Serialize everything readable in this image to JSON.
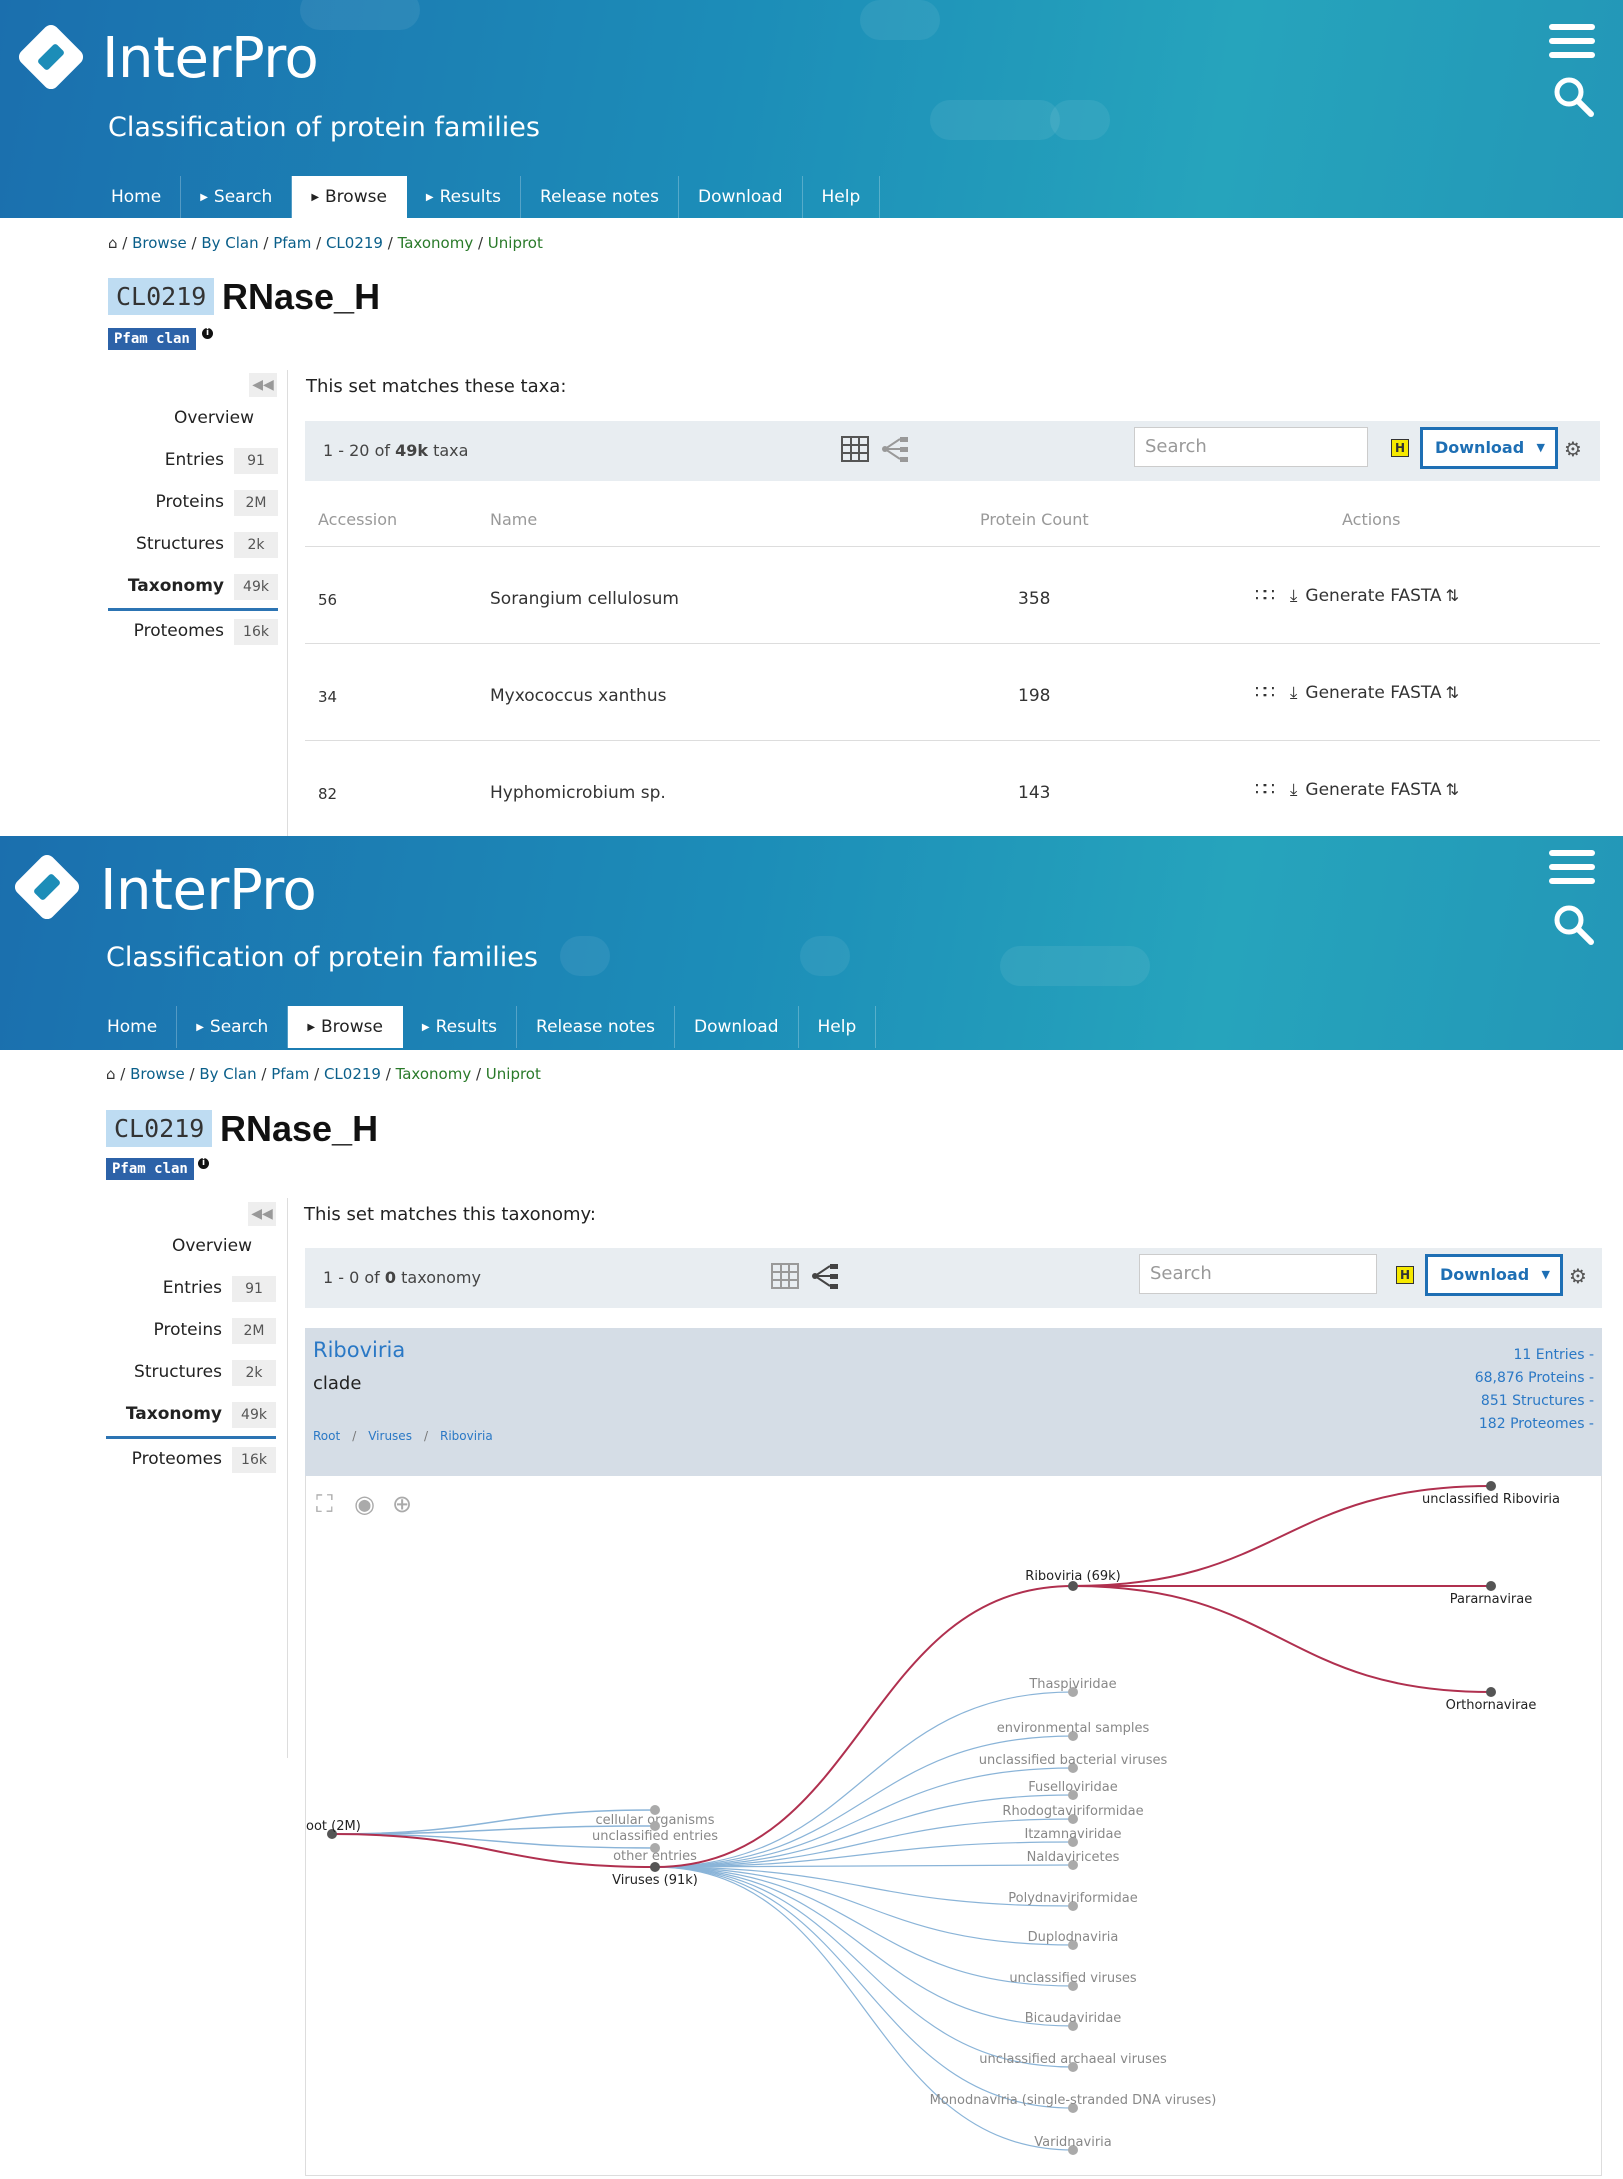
{
  "header": {
    "brand": "InterPro",
    "tagline": "Classification of protein families",
    "nav": [
      "Home",
      "Search",
      "Browse",
      "Results",
      "Release notes",
      "Download",
      "Help"
    ],
    "active_tab": "Browse"
  },
  "breadcrumb": {
    "home_icon": "home-icon",
    "items": [
      "Browse",
      "By Clan",
      "Pfam",
      "CL0219",
      "Taxonomy",
      "Uniprot"
    ]
  },
  "entry": {
    "accession": "CL0219",
    "name": "RNase_H",
    "type_badge": "Pfam clan",
    "info": "i"
  },
  "sidebar": {
    "items": [
      {
        "label": "Overview",
        "count": ""
      },
      {
        "label": "Entries",
        "count": "91"
      },
      {
        "label": "Proteins",
        "count": "2M"
      },
      {
        "label": "Structures",
        "count": "2k"
      },
      {
        "label": "Taxonomy",
        "count": "49k"
      },
      {
        "label": "Proteomes",
        "count": "16k"
      }
    ],
    "selected": "Taxonomy"
  },
  "panel1": {
    "set_text": "This set matches these taxa:",
    "range_prefix": "1 - 20 of ",
    "range_bold": "49k",
    "range_suffix": " taxa",
    "search_placeholder": "Search",
    "h_badge": "H",
    "download_label": "Download",
    "columns": [
      "Accession",
      "Name",
      "Protein Count",
      "Actions"
    ],
    "rows": [
      {
        "accession": "56",
        "name": "Sorangium cellulosum",
        "count": "358",
        "action": "Generate FASTA"
      },
      {
        "accession": "34",
        "name": "Myxococcus xanthus",
        "count": "198",
        "action": "Generate FASTA"
      },
      {
        "accession": "82",
        "name": "Hyphomicrobium sp.",
        "count": "143",
        "action": "Generate FASTA"
      }
    ]
  },
  "panel2": {
    "set_text": "This set matches this taxonomy:",
    "range_prefix": "1 - 0 of ",
    "range_bold": "0",
    "range_suffix": " taxonomy",
    "search_placeholder": "Search",
    "h_badge": "H",
    "download_label": "Download",
    "taxon": {
      "name": "Riboviria",
      "rank": "clade",
      "path": [
        "Root",
        "Viruses",
        "Riboviria"
      ],
      "stats": [
        "11 Entries -",
        "68,876 Proteins -",
        "851 Structures -",
        "182 Proteomes -"
      ]
    },
    "tree": {
      "root": "oot (2M)",
      "level1": [
        "cellular organisms",
        "unclassified entries",
        "other entries",
        "Viruses (91k)"
      ],
      "riboviria": "Riboviria (69k)",
      "riboviria_children": [
        "unclassified Riboviria",
        "Pararnavirae",
        "Orthornavirae"
      ],
      "virus_children": [
        "Thaspiviridae",
        "environmental samples",
        "unclassified bacterial viruses",
        "Fuselloviridae",
        "Rhodogtaviriformidae",
        "Itzamnaviridae",
        "Naldaviricetes",
        "Polydnaviriformidae",
        "Duplodnaviria",
        "unclassified viruses",
        "Bicaudaviridae",
        "unclassified archaeal viruses",
        "Monodnaviria (single-stranded DNA viruses)",
        "Varidnaviria"
      ],
      "highlight_color": "#b0304f",
      "branch_color": "#8ab4d8"
    }
  },
  "colors": {
    "accent": "#1e6fb4",
    "header": "#1c8db8"
  }
}
